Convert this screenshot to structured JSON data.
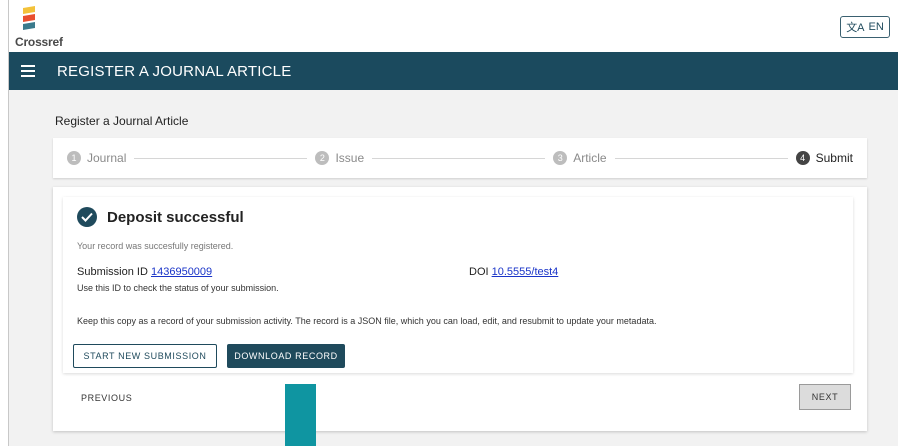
{
  "brand": {
    "name": "Crossref",
    "colors": [
      "#f3c23a",
      "#e94f2f",
      "#3a7a8c"
    ]
  },
  "language": {
    "label": "EN",
    "icon": "translate-icon"
  },
  "nav": {
    "title": "REGISTER A JOURNAL ARTICLE",
    "menu_icon": "menu-icon"
  },
  "page": {
    "heading": "Register a Journal Article"
  },
  "steps": [
    {
      "num": "1",
      "label": "Journal",
      "active": false
    },
    {
      "num": "2",
      "label": "Issue",
      "active": false
    },
    {
      "num": "3",
      "label": "Article",
      "active": false
    },
    {
      "num": "4",
      "label": "Submit",
      "active": true
    }
  ],
  "result": {
    "title": "Deposit successful",
    "subtitle": "Your record was succesfully registered.",
    "submission_label": "Submission ID",
    "submission_id": "1436950009",
    "submission_hint": "Use this ID to check the status of your submission.",
    "doi_label": "DOI",
    "doi_value": "10.5555/test4",
    "keep_note": "Keep this copy as a record of your submission activity. The record is a JSON file, which you can load, edit, and resubmit to update your metadata."
  },
  "buttons": {
    "start_new": "START NEW SUBMISSION",
    "download": "DOWNLOAD RECORD",
    "previous": "PREVIOUS",
    "next": "NEXT"
  },
  "accent": {
    "primary": "#1b4a5e",
    "highlight": "#0f95a1",
    "link": "#1a34c8"
  }
}
